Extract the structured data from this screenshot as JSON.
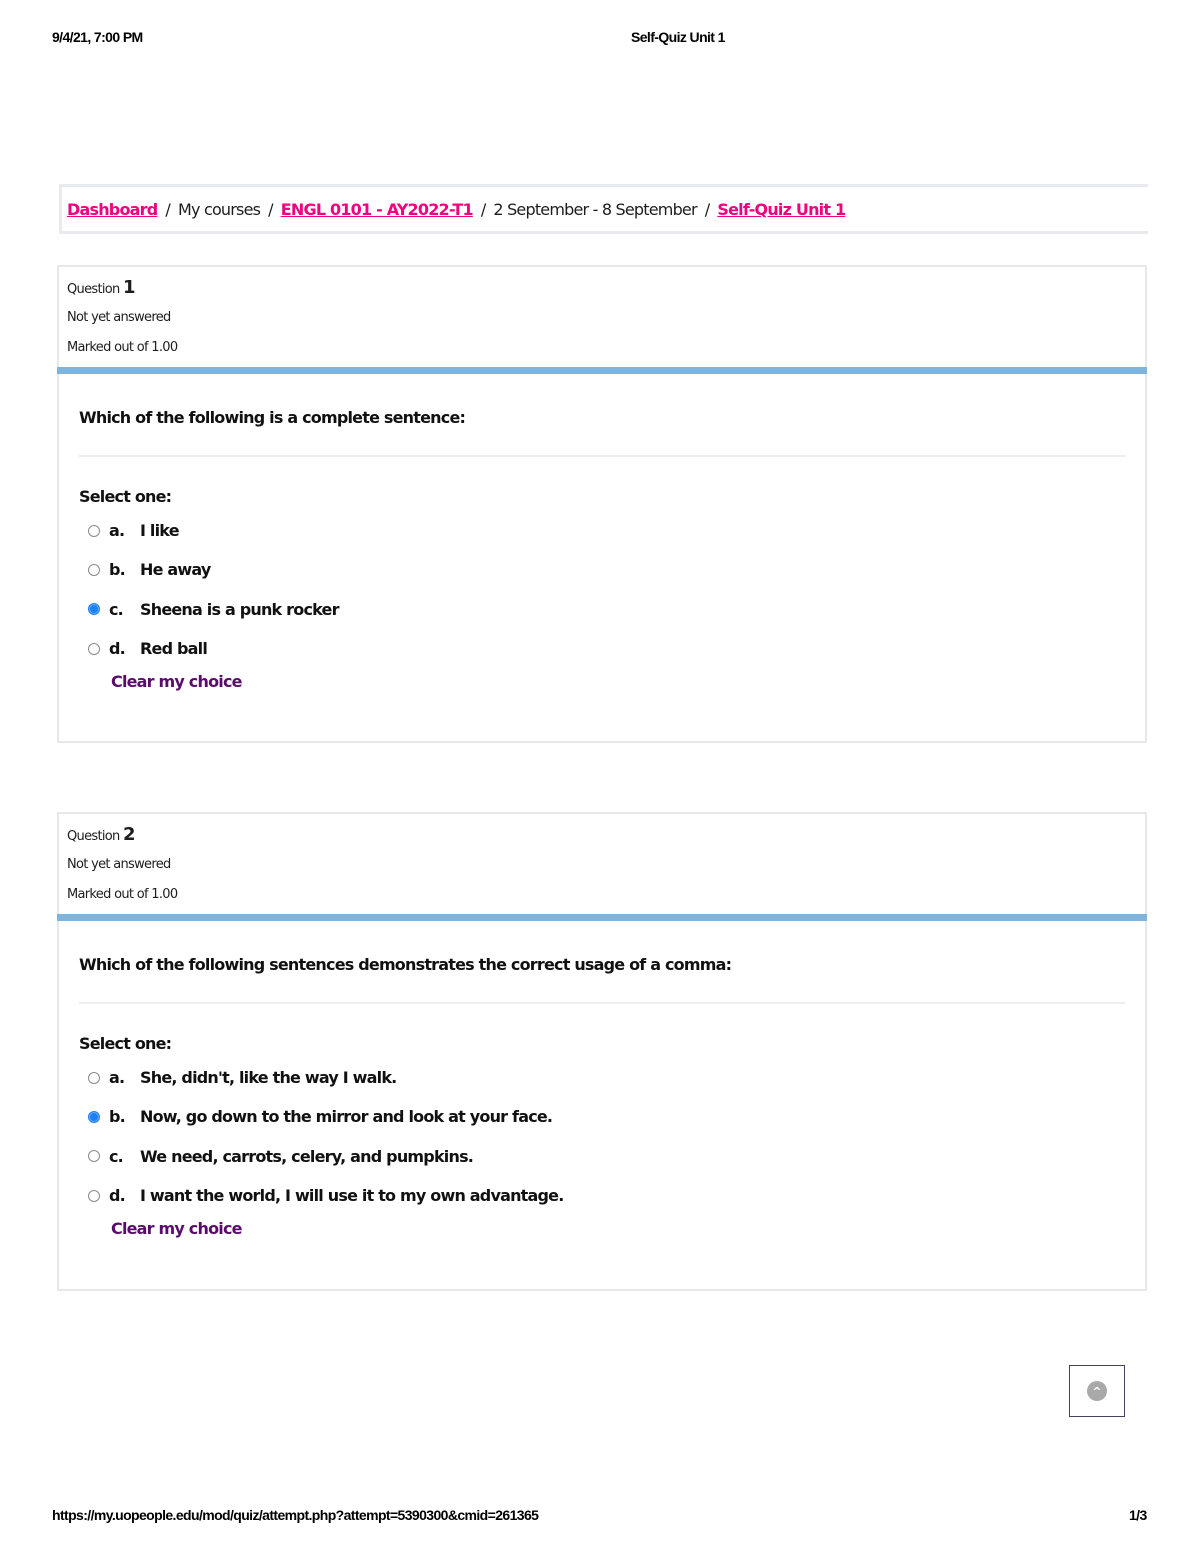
{
  "print_header": {
    "datetime": "9/4/21, 7:00 PM",
    "title": "Self-Quiz Unit 1"
  },
  "print_footer": {
    "url": "https://my.uopeople.edu/mod/quiz/attempt.php?attempt=5390300&cmid=261365",
    "page": "1/3"
  },
  "breadcrumb": {
    "items": [
      {
        "label": "Dashboard",
        "link": true
      },
      {
        "label": "My courses",
        "link": false
      },
      {
        "label": "ENGL 0101 - AY2022-T1",
        "link": true
      },
      {
        "label": "2 September - 8 September",
        "link": false
      },
      {
        "label": "Self-Quiz Unit 1",
        "link": true
      }
    ],
    "separator": "/"
  },
  "colors": {
    "link": "#f0007f",
    "accent_bar": "#7fb5dc",
    "radio_selected": "#1e7ff7",
    "clear_choice": "#5a0b6b"
  },
  "questions": [
    {
      "label": "Question",
      "number": "1",
      "state": "Not yet answered",
      "grade": "Marked out of 1.00",
      "text": "Which of the following is a complete sentence:",
      "prompt": "Select one:",
      "answers": [
        {
          "letter": "a.",
          "text": "I like",
          "selected": false
        },
        {
          "letter": "b.",
          "text": "He away",
          "selected": false
        },
        {
          "letter": "c.",
          "text": "Sheena is a punk rocker",
          "selected": true
        },
        {
          "letter": "d.",
          "text": "Red ball",
          "selected": false
        }
      ],
      "clear_label": "Clear my choice"
    },
    {
      "label": "Question",
      "number": "2",
      "state": "Not yet answered",
      "grade": "Marked out of 1.00",
      "text": "Which of the following sentences demonstrates the correct usage of a comma:",
      "prompt": "Select one:",
      "answers": [
        {
          "letter": "a.",
          "text": "She, didn't, like the way I walk.",
          "selected": false
        },
        {
          "letter": "b.",
          "text": "Now, go down to the mirror and look at your face.",
          "selected": true
        },
        {
          "letter": "c.",
          "text": "We need, carrots, celery, and pumpkins.",
          "selected": false
        },
        {
          "letter": "d.",
          "text": "I want the world, I will use it to my own advantage.",
          "selected": false
        }
      ],
      "clear_label": "Clear my choice"
    }
  ],
  "back_to_top": {
    "icon": "chevron-up-icon",
    "glyph": "^"
  }
}
